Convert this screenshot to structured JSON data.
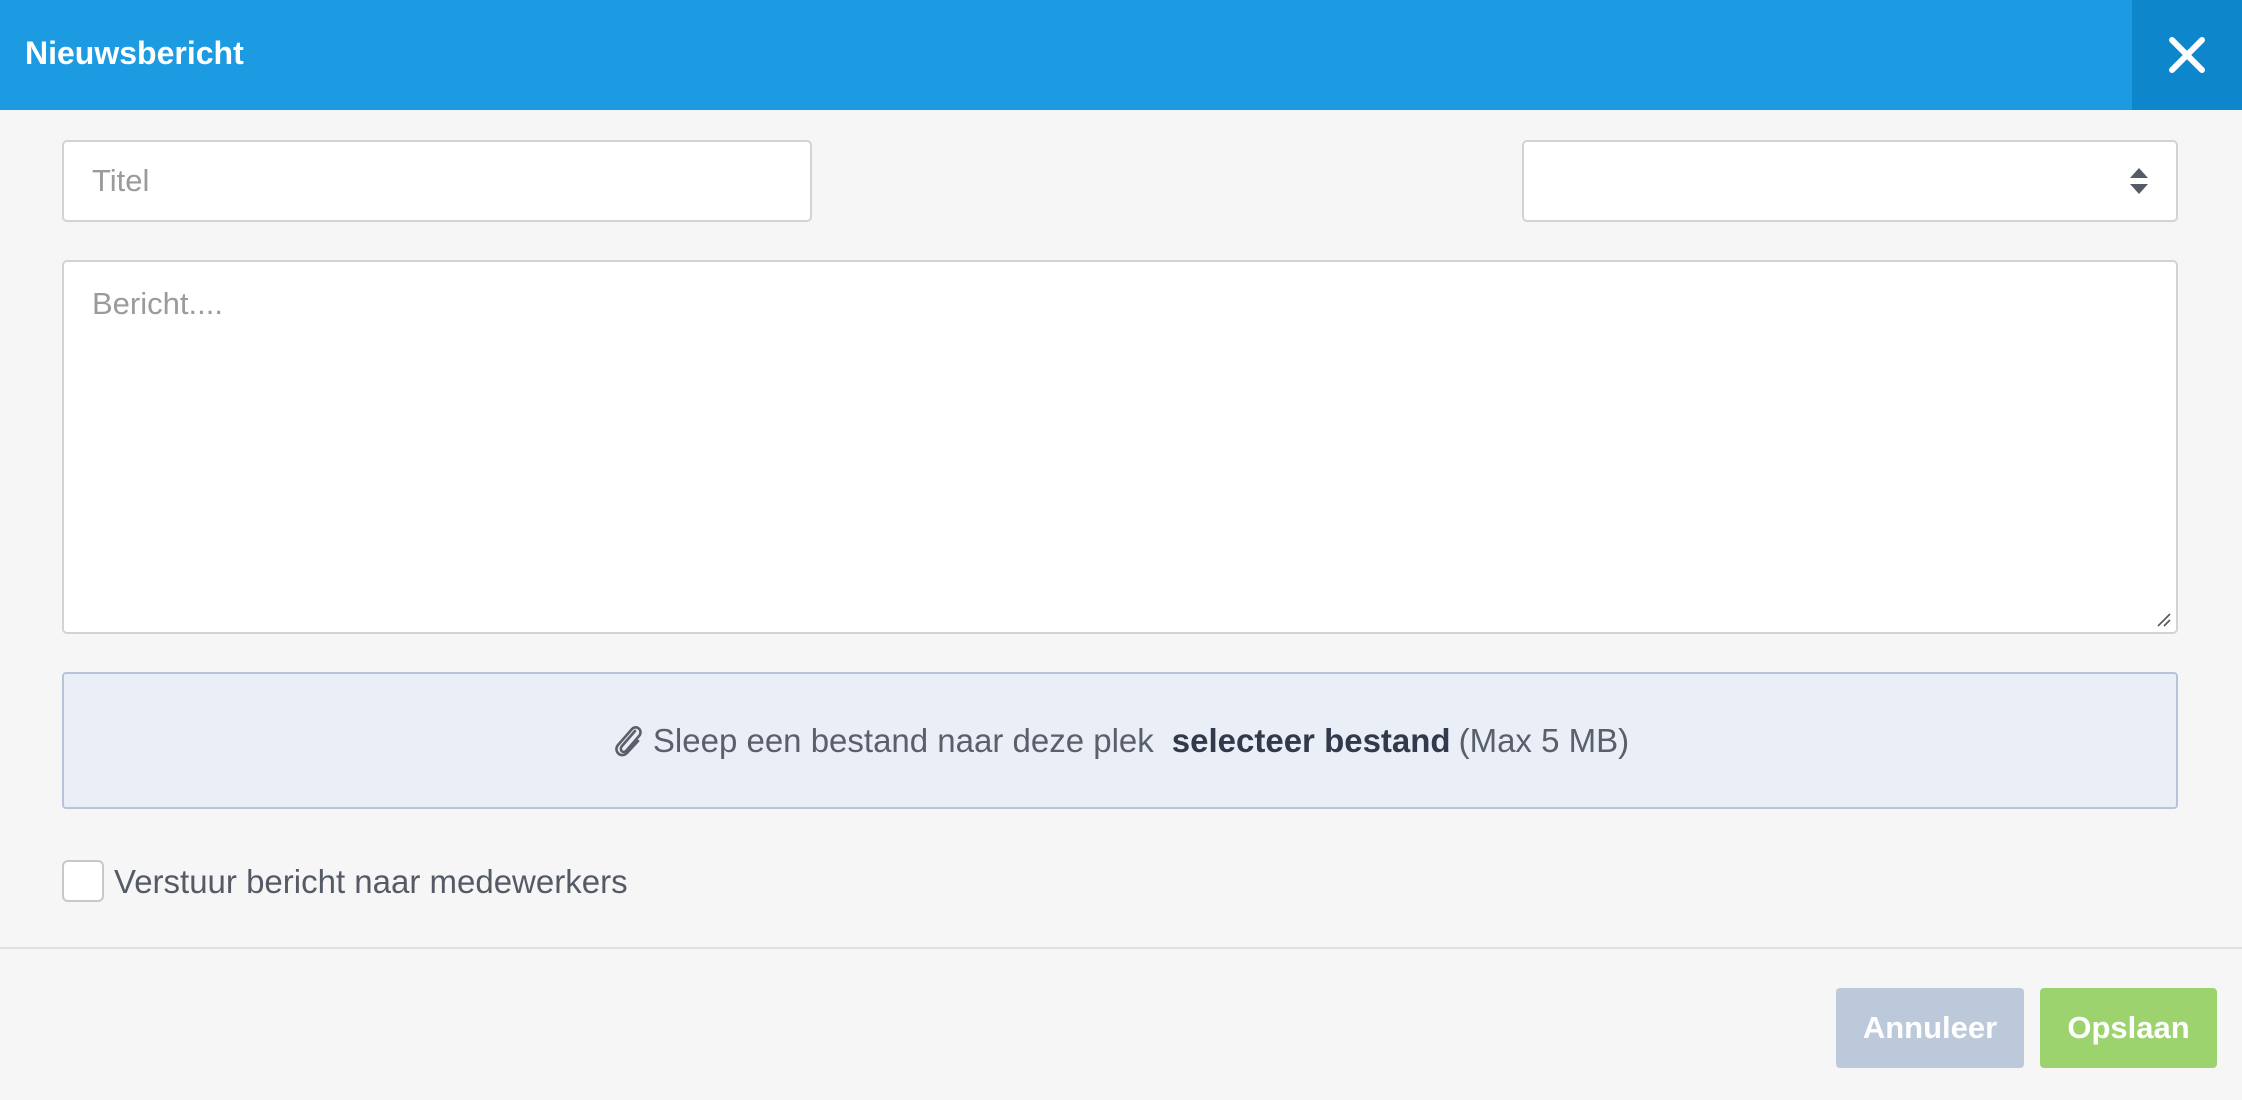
{
  "dialog": {
    "title": "Nieuwsbericht"
  },
  "form": {
    "title_placeholder": "Titel",
    "title_value": "",
    "category_value": "",
    "message_placeholder": "Bericht....",
    "message_value": ""
  },
  "dropzone": {
    "text": "Sleep een bestand naar deze plek",
    "select_label": "selecteer bestand",
    "max_size": "(Max 5 MB)",
    "icon": "paperclip-icon"
  },
  "options": {
    "notify_label": "Verstuur bericht naar medewerkers",
    "notify_checked": false
  },
  "footer": {
    "cancel_label": "Annuleer",
    "save_label": "Opslaan"
  },
  "colors": {
    "header": "#1c9be2",
    "close_button": "#0d86cb",
    "cancel_button": "#bcc9db",
    "save_button": "#9dd36e",
    "dropzone_bg": "#e9eef7"
  }
}
